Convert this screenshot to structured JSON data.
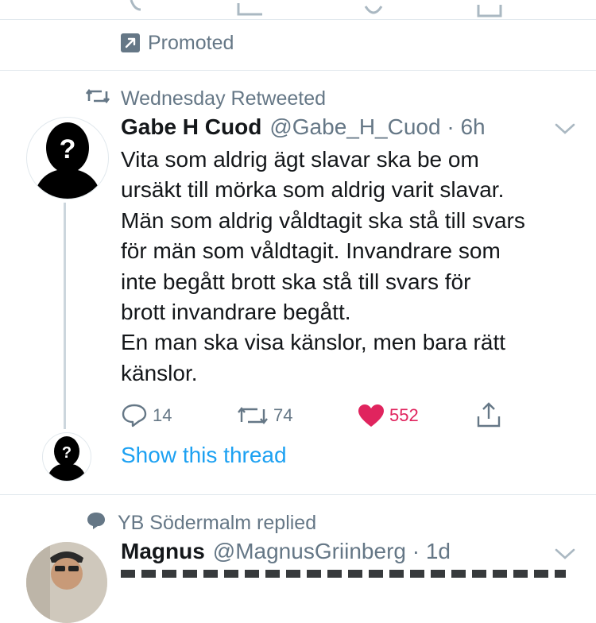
{
  "promoted": {
    "label": "Promoted"
  },
  "tweet": {
    "social_context": "Wednesday Retweeted",
    "author_name": "Gabe H Cuod",
    "author_meta": "@Gabe_H_Cuod · 6h",
    "text": "Vita som aldrig ägt slavar ska be om\nursäkt till mörka som aldrig varit slavar.\nMän som aldrig våldtagit ska stå till svars\nför män som våldtagit. Invandrare som\ninte begått brott ska stå till svars för\nbrott invandrare begått.\nEn man ska visa känslor, men bara rätt\nkänslor.",
    "replies": "14",
    "retweets": "74",
    "likes": "552",
    "show_thread": "Show this thread"
  },
  "next_tweet": {
    "social_context": "YB Södermalm replied",
    "author_name": "Magnus",
    "author_meta": "@MagnusGriinberg · 1d"
  },
  "colors": {
    "accent": "#1da1f2",
    "like": "#e0245e",
    "muted": "#657786",
    "divider": "#e1e8ed"
  },
  "icons": [
    "promoted-icon",
    "retweet-icon",
    "chevron-down-icon",
    "reply-icon",
    "like-icon",
    "share-icon",
    "speech-bubble-icon",
    "silhouette-avatar",
    "user-avatar"
  ]
}
